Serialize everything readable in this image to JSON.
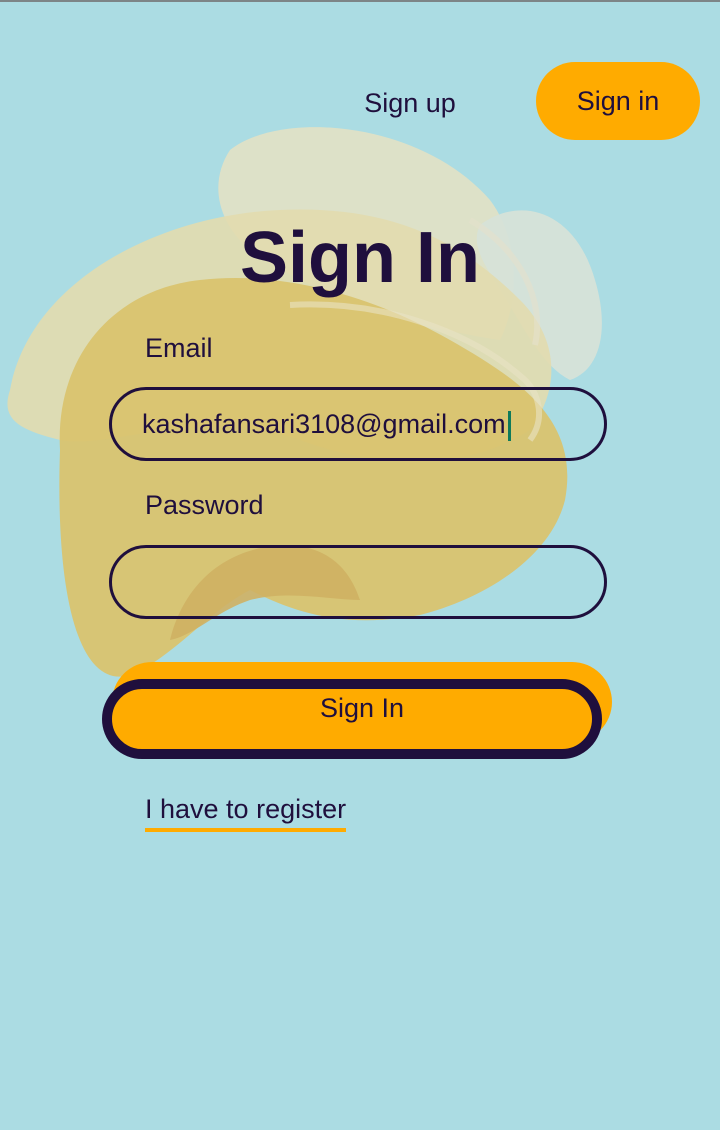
{
  "nav": {
    "signup_label": "Sign up",
    "signin_label": "Sign in"
  },
  "form": {
    "title": "Sign In",
    "email_label": "Email",
    "email_value": "kashafansari3108@gmail.com",
    "password_label": "Password",
    "password_value": "",
    "submit_label": "Sign In",
    "register_link": "I have to register"
  },
  "colors": {
    "background": "#abdce3",
    "accent": "#ffab00",
    "text": "#1f0f3d",
    "caret": "#0f7a5a"
  }
}
